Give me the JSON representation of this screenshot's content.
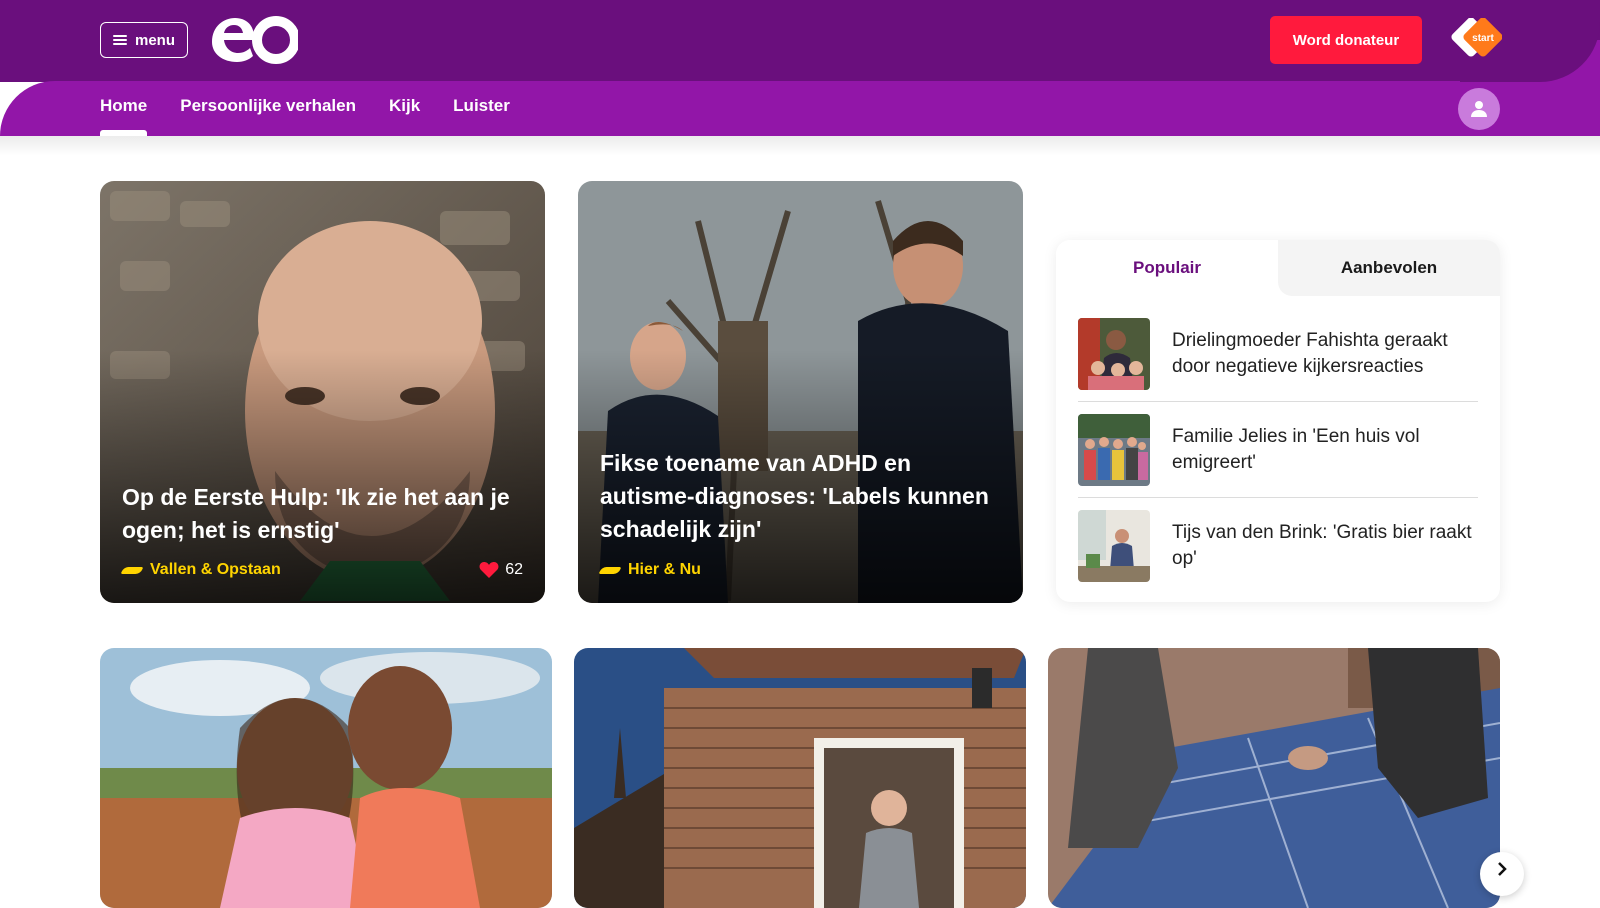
{
  "header": {
    "menu_label": "menu",
    "logo_alt": "eo",
    "donate_label": "Word donateur",
    "npo_label": "start",
    "brand_color": "#6a0f7d",
    "nav_color": "#9216a8",
    "donate_color": "#ff1a3d"
  },
  "nav": {
    "items": [
      {
        "label": "Home",
        "active": true
      },
      {
        "label": "Persoonlijke verhalen"
      },
      {
        "label": "Kijk"
      },
      {
        "label": "Luister"
      }
    ]
  },
  "featured": [
    {
      "title": "Op de Eerste Hulp: 'Ik zie het aan je ogen; het is ernstig'",
      "category": "Vallen & Opstaan",
      "likes": "62"
    },
    {
      "title": "Fikse toename van ADHD en autisme-diagnoses: 'Labels kunnen schadelijk zijn'",
      "category": "Hier & Nu"
    }
  ],
  "panel": {
    "tabs": [
      "Populair",
      "Aanbevolen"
    ],
    "items": [
      {
        "title": "Drielingmoeder Fahishta geraakt door negatieve kijkersreacties"
      },
      {
        "title": "Familie Jelies in 'Een huis vol emigreert'"
      },
      {
        "title": "Tijs van den Brink: 'Gratis bier raakt op'"
      }
    ]
  }
}
